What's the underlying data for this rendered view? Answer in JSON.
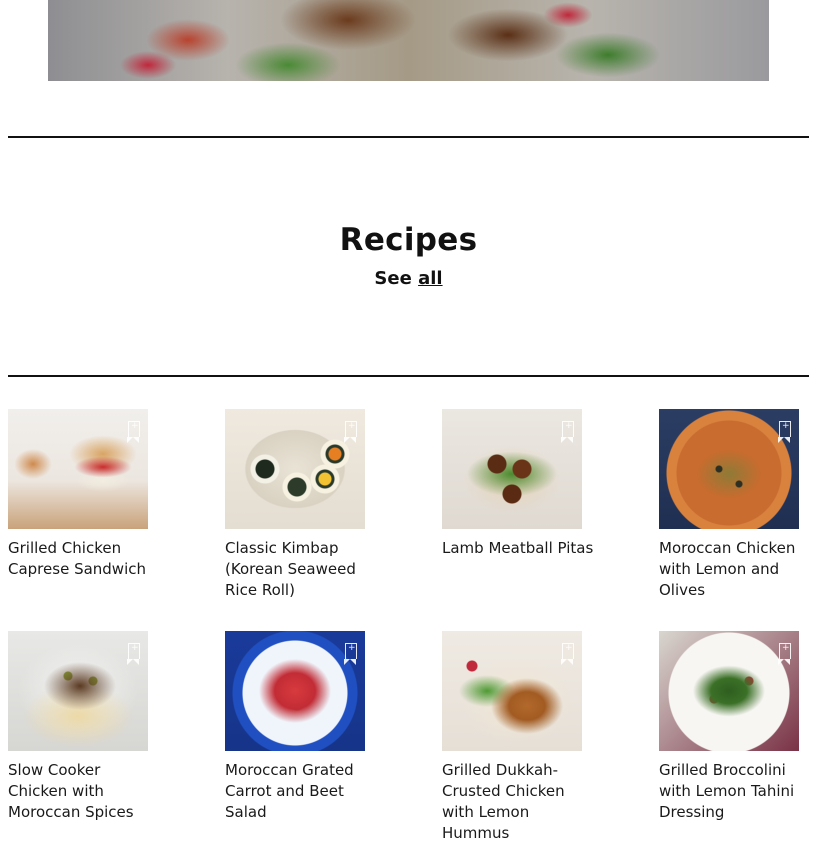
{
  "recipes_section": {
    "title": "Recipes",
    "see_prefix": "See",
    "see_link": "all"
  },
  "recipes": [
    {
      "title": "Grilled Chicken Caprese Sandwich",
      "image_alt": "grilled-chicken-caprese-sandwich-photo"
    },
    {
      "title": "Classic Kimbap (Korean Seaweed Rice Roll)",
      "image_alt": "classic-kimbap-photo"
    },
    {
      "title": "Lamb Meatball Pitas",
      "image_alt": "lamb-meatball-pitas-photo"
    },
    {
      "title": "Moroccan Chicken with Lemon and Olives",
      "image_alt": "moroccan-chicken-photo"
    },
    {
      "title": "Slow Cooker Chicken with Moroccan Spices",
      "image_alt": "slow-cooker-chicken-photo"
    },
    {
      "title": "Moroccan Grated Carrot and Beet Salad",
      "image_alt": "carrot-beet-salad-photo"
    },
    {
      "title": "Grilled Dukkah-Crusted Chicken with Lemon Hummus",
      "image_alt": "dukkah-chicken-photo"
    },
    {
      "title": "Grilled Broccolini with Lemon Tahini Dressing",
      "image_alt": "grilled-broccolini-photo"
    }
  ],
  "icons": {
    "bookmark": "bookmark-add-icon"
  }
}
